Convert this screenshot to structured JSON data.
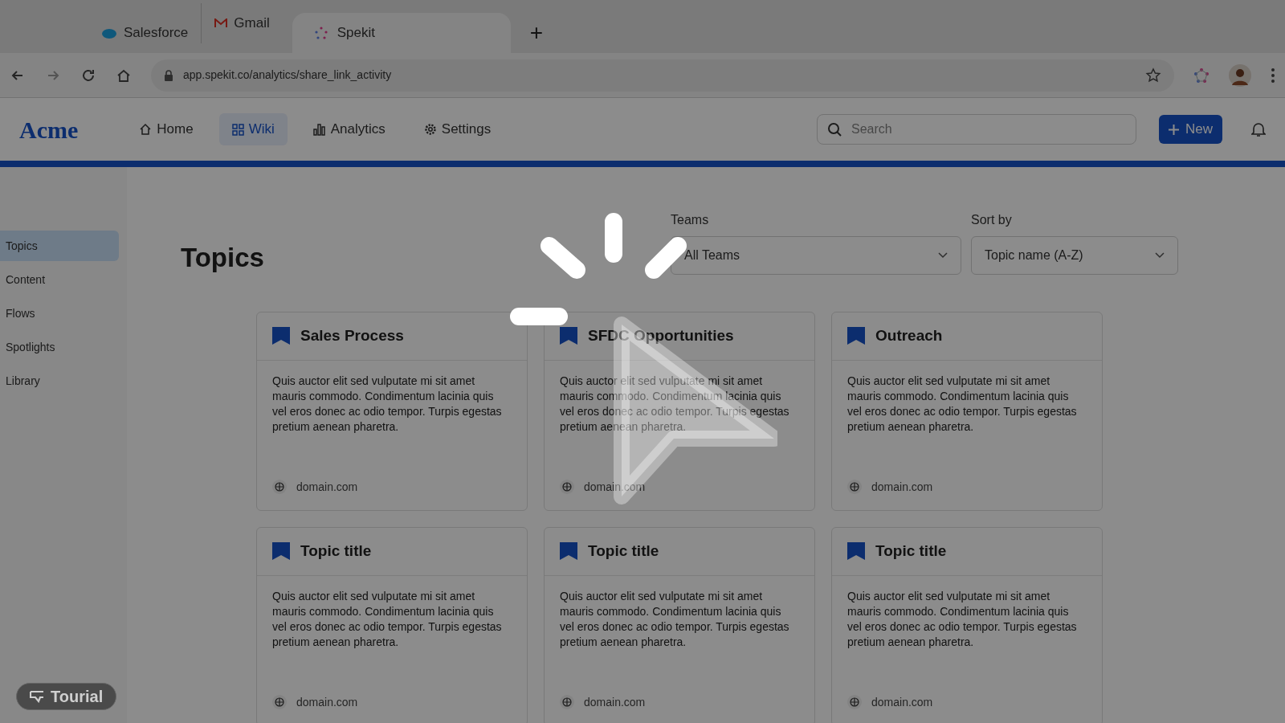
{
  "browser": {
    "tabs": [
      {
        "label": "Salesforce",
        "selected": false
      },
      {
        "label": "Gmail",
        "selected": false
      },
      {
        "label": "Spekit",
        "selected": true
      }
    ],
    "new_tab": "+",
    "url": "app.spekit.co/analytics/share_link_activity"
  },
  "header": {
    "logo": "Acme",
    "nav": [
      {
        "label": "Home",
        "selected": false
      },
      {
        "label": "Wiki",
        "selected": true
      },
      {
        "label": "Analytics",
        "selected": false
      },
      {
        "label": "Settings",
        "selected": false
      }
    ],
    "search": {
      "placeholder": "Search"
    },
    "new_button": "New"
  },
  "sidebar": {
    "items": [
      {
        "label": "Topics",
        "selected": true
      },
      {
        "label": "Content",
        "selected": false
      },
      {
        "label": "Flows",
        "selected": false
      },
      {
        "label": "Spotlights",
        "selected": false
      },
      {
        "label": "Library",
        "selected": false
      }
    ]
  },
  "page": {
    "title": "Topics",
    "filters": [
      {
        "label": "Teams",
        "value": "All Teams"
      },
      {
        "label": "Sort by",
        "value": "Topic name (A-Z)"
      }
    ],
    "cards": [
      {
        "title": "Sales Process",
        "body": "Quis auctor elit sed vulputate mi sit amet mauris commodo. Condimentum lacinia quis vel eros donec ac odio tempor. Turpis egestas pretium aenean pharetra.",
        "domain": "domain.com"
      },
      {
        "title": "SFDC Opportunities",
        "body": "Quis auctor elit sed vulputate mi sit amet mauris commodo. Condimentum lacinia quis vel eros donec ac odio tempor. Turpis egestas pretium aenean pharetra.",
        "domain": "domain.com"
      },
      {
        "title": "Outreach",
        "body": "Quis auctor elit sed vulputate mi sit amet mauris commodo. Condimentum lacinia quis vel eros donec ac odio tempor. Turpis egestas pretium aenean pharetra.",
        "domain": "domain.com"
      },
      {
        "title": "Topic title",
        "body": "Quis auctor elit sed vulputate mi sit amet mauris commodo. Condimentum lacinia quis vel eros donec ac odio tempor. Turpis egestas pretium aenean pharetra.",
        "domain": "domain.com"
      },
      {
        "title": "Topic title",
        "body": "Quis auctor elit sed vulputate mi sit amet mauris commodo. Condimentum lacinia quis vel eros donec ac odio tempor. Turpis egestas pretium aenean pharetra.",
        "domain": "domain.com"
      },
      {
        "title": "Topic title",
        "body": "Quis auctor elit sed vulputate mi sit amet mauris commodo. Condimentum lacinia quis vel eros donec ac odio tempor. Turpis egestas pretium aenean pharetra.",
        "domain": "domain.com"
      }
    ]
  },
  "badge": "Tourial"
}
